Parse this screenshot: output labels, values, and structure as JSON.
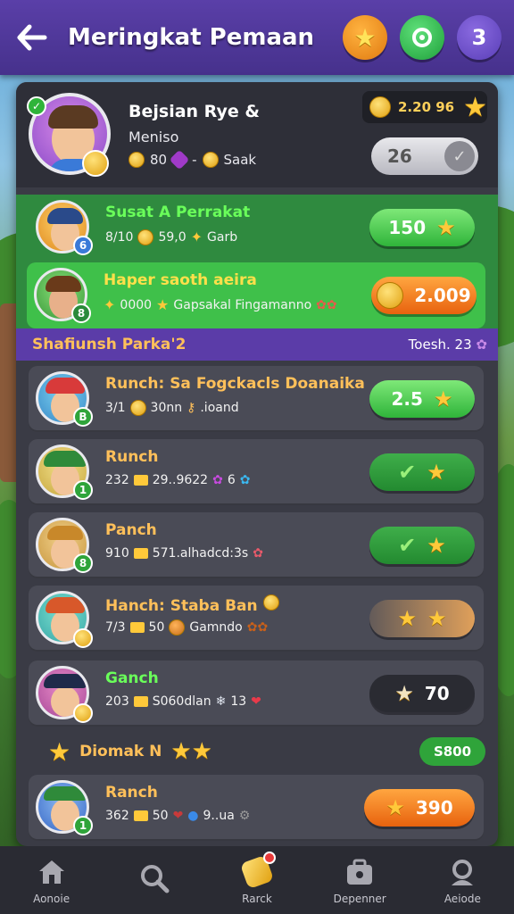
{
  "header": {
    "title": "Meringkat Pemaan",
    "buttons": [
      {
        "icon": "star-icon"
      },
      {
        "icon": "refresh-icon"
      },
      {
        "label": "3"
      }
    ]
  },
  "profile": {
    "name": "Bejsian Rye &",
    "subtitle": "Meniso",
    "stats": {
      "coins": "80",
      "extra": "Saak"
    },
    "coins_pill": "2.20 96",
    "toggle_value": "26"
  },
  "featured": [
    {
      "name": "Susat A Perrakat",
      "meta_a": "8/10",
      "meta_b": "59,0",
      "meta_c": "Garb",
      "button": "150",
      "badge": "6",
      "name_color": "#6aff5a"
    },
    {
      "name": "Haper saoth aeira",
      "meta_a": "0000",
      "meta_b": "Gapsakal Fingamanno",
      "button": "2.009",
      "badge": "8",
      "name_color": "#ffe04a"
    }
  ],
  "section": {
    "title": "Shafiunsh Parka'2",
    "right": "Toesh. 23"
  },
  "list": [
    {
      "name": "Runch: Sa Fogckacls Doanaika",
      "meta_a": "3/1",
      "meta_b": "30nn",
      "meta_c": ".ioand",
      "button": "2.5",
      "badge": "B",
      "btn": "green",
      "name_color": "#ffc05a"
    },
    {
      "name": "Runch",
      "meta_a": "232",
      "meta_b": "29..9622",
      "meta_c": "6",
      "button": "",
      "badge": "1",
      "btn": "check",
      "name_color": "#ffc05a"
    },
    {
      "name": "Panch",
      "meta_a": "910",
      "meta_b": "571.alhadcd:3s",
      "meta_c": "",
      "button": "",
      "badge": "8",
      "btn": "check",
      "name_color": "#ffc05a"
    },
    {
      "name": "Hanch: Staba Ban",
      "meta_a": "7/3",
      "meta_b": "50",
      "meta_c": "Gamndo",
      "button": "",
      "badge": "",
      "btn": "tan",
      "name_color": "#ffc05a"
    },
    {
      "name": "Ganch",
      "meta_a": "203",
      "meta_b": "S060dlan",
      "meta_c": "13",
      "button": "70",
      "badge": "",
      "btn": "dark",
      "name_color": "#6aff5a"
    },
    {
      "name": "Ranch",
      "meta_a": "362",
      "meta_b": "50",
      "meta_c": "9..ua",
      "button": "390",
      "badge": "1",
      "btn": "orange",
      "name_color": "#ffc05a"
    }
  ],
  "divider": {
    "text": "Diomak N",
    "pill": "S800"
  },
  "nav": [
    {
      "label": "Aonoie",
      "icon": "home-icon"
    },
    {
      "label": "",
      "icon": "search-icon"
    },
    {
      "label": "Rarck",
      "icon": "rank-icon"
    },
    {
      "label": "Depenner",
      "icon": "shop-icon"
    },
    {
      "label": "Aeiode",
      "icon": "profile-icon"
    }
  ],
  "colors": {
    "header": "#4a338f",
    "panel": "#3a3b45",
    "accent_green": "#2fb43a",
    "accent_orange": "#e8620e",
    "section": "#5b3ca8"
  }
}
